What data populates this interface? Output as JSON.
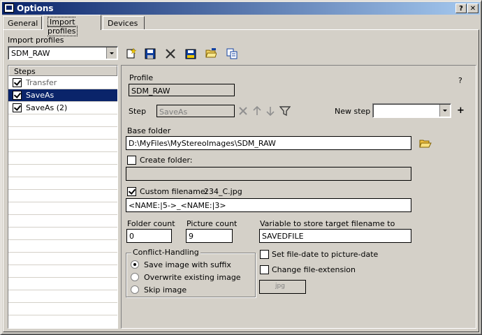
{
  "window": {
    "title": "Options",
    "help_btn": "?",
    "close_btn": "✕"
  },
  "tabs": [
    {
      "label": "General"
    },
    {
      "label": "Import profiles"
    },
    {
      "label": "Devices"
    }
  ],
  "import_profiles": {
    "label": "Import profiles",
    "selected": "SDM_RAW",
    "toolbar_icons": [
      "new-icon",
      "save-icon",
      "delete-icon",
      "save-as-icon",
      "open-icon",
      "copy-icon"
    ]
  },
  "steps": {
    "header": "Steps",
    "items": [
      {
        "label": "Transfer",
        "checked": true,
        "selected": false,
        "disabled": true
      },
      {
        "label": "SaveAs",
        "checked": true,
        "selected": true,
        "disabled": false
      },
      {
        "label": "SaveAs (2)",
        "checked": true,
        "selected": false,
        "disabled": false
      }
    ]
  },
  "profile": {
    "label": "Profile",
    "value": "SDM_RAW",
    "help": "?"
  },
  "step": {
    "label": "Step",
    "value": "SaveAs",
    "new_step_label": "New step",
    "new_step_value": "",
    "add": "+"
  },
  "base_folder": {
    "label": "Base folder",
    "value": "D:\\MyFiles\\MyStereoImages\\SDM_RAW"
  },
  "create_folder": {
    "label": "Create folder:",
    "checked": false,
    "value": ""
  },
  "custom_filename": {
    "label": "Custom filename:",
    "checked": true,
    "preview": "234_C.jpg",
    "value": "<NAME:|5->_<NAME:|3>"
  },
  "folder_count": {
    "label": "Folder count",
    "value": "0"
  },
  "picture_count": {
    "label": "Picture count",
    "value": "9"
  },
  "variable": {
    "label": "Variable to store target filename to",
    "value": "SAVEDFILE"
  },
  "conflict": {
    "label": "Conflict-Handling",
    "options": [
      {
        "label": "Save image with suffix",
        "selected": true
      },
      {
        "label": "Overwrite existing image",
        "selected": false
      },
      {
        "label": "Skip image",
        "selected": false
      }
    ]
  },
  "set_file_date": {
    "label": "Set file-date to picture-date",
    "checked": false
  },
  "change_ext": {
    "label": "Change file-extension",
    "checked": false,
    "value": "jpg"
  }
}
